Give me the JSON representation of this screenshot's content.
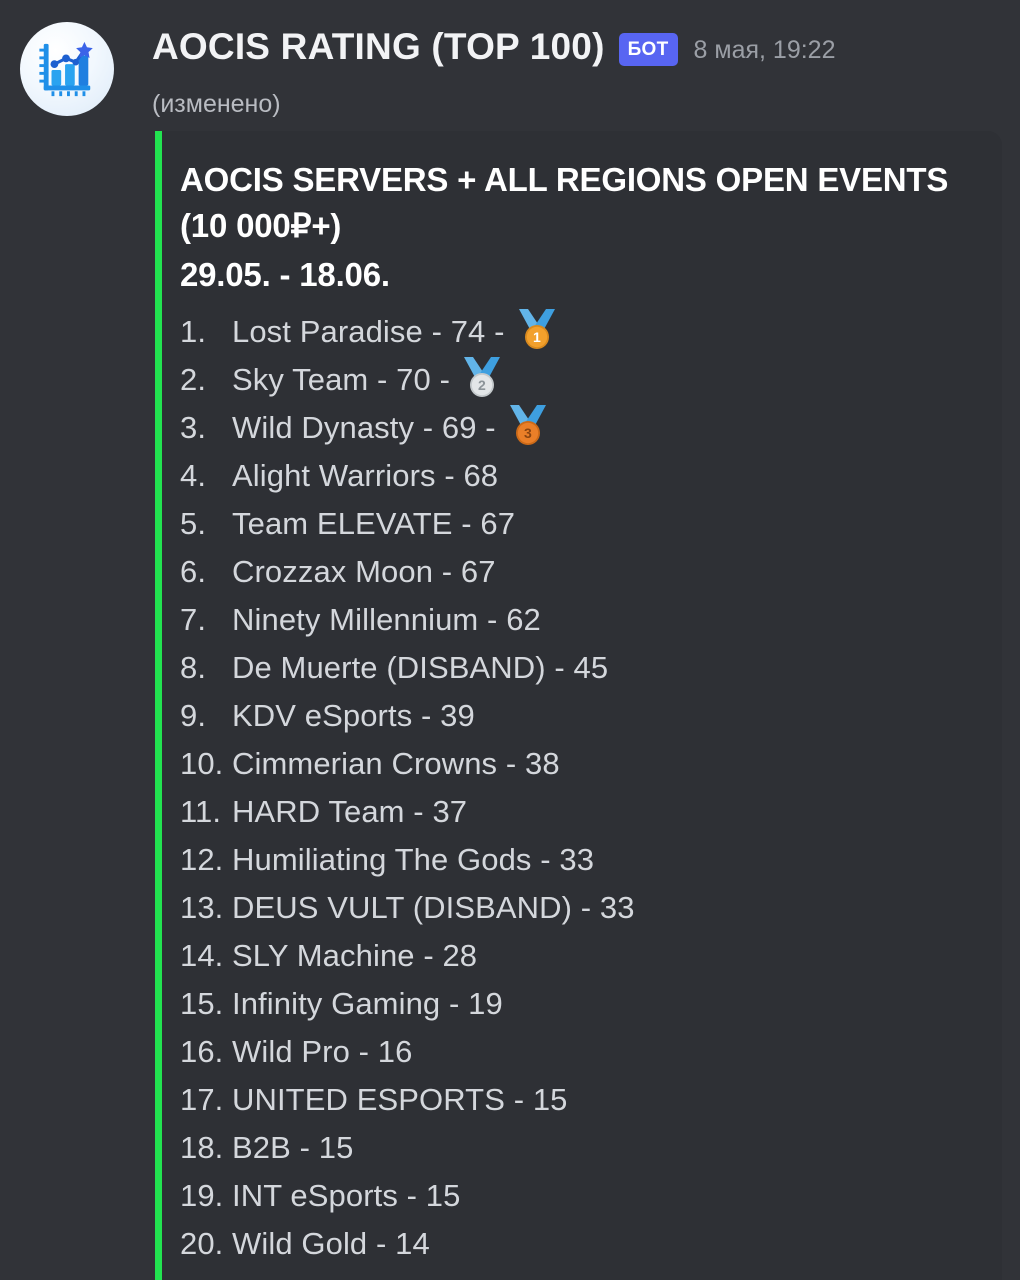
{
  "message": {
    "author": "AOCIS RATING (TOP 100)",
    "bot_badge": "БОТ",
    "timestamp": "8 мая, 19:22",
    "edited_note": "(изменено)",
    "avatar_icon": "bar-chart-star-icon",
    "accent_color": "#22e350",
    "badge_color": "#5865F2"
  },
  "embed": {
    "title": "AOCIS SERVERS + ALL REGIONS OPEN EVENTS (10 000₽+)",
    "title_line1": "AOCIS SERVERS + ALL REGIONS OPEN EVENTS",
    "title_line2": "(10 000₽+)",
    "date_range": "29.05. - 18.06.",
    "entries": [
      {
        "rank": "1.",
        "text": "Lost Paradise - 74 -",
        "team": "Lost Paradise",
        "points": 74,
        "medal": "gold-medal-icon"
      },
      {
        "rank": "2.",
        "text": "Sky Team - 70 -",
        "team": "Sky Team",
        "points": 70,
        "medal": "silver-medal-icon"
      },
      {
        "rank": "3.",
        "text": "Wild Dynasty - 69 -",
        "team": "Wild Dynasty",
        "points": 69,
        "medal": "bronze-medal-icon"
      },
      {
        "rank": "4.",
        "text": "Alight Warriors - 68",
        "team": "Alight Warriors",
        "points": 68,
        "medal": null
      },
      {
        "rank": "5.",
        "text": "Team ELEVATE - 67",
        "team": "Team ELEVATE",
        "points": 67,
        "medal": null
      },
      {
        "rank": "6.",
        "text": "Crozzax Moon - 67",
        "team": "Crozzax Moon",
        "points": 67,
        "medal": null
      },
      {
        "rank": "7.",
        "text": "Ninety Millennium - 62",
        "team": "Ninety Millennium",
        "points": 62,
        "medal": null
      },
      {
        "rank": "8.",
        "text": "De Muerte (DISBAND) - 45",
        "team": "De Muerte (DISBAND)",
        "points": 45,
        "medal": null
      },
      {
        "rank": "9.",
        "text": "KDV eSports - 39",
        "team": "KDV eSports",
        "points": 39,
        "medal": null
      },
      {
        "rank": "10.",
        "text": "Cimmerian Crowns - 38",
        "team": "Cimmerian Crowns",
        "points": 38,
        "medal": null
      },
      {
        "rank": "11.",
        "text": "HARD Team - 37",
        "team": "HARD Team",
        "points": 37,
        "medal": null
      },
      {
        "rank": "12.",
        "text": "Humiliating The Gods - 33",
        "team": "Humiliating The Gods",
        "points": 33,
        "medal": null
      },
      {
        "rank": "13.",
        "text": "DEUS VULT (DISBAND) - 33",
        "team": "DEUS VULT (DISBAND)",
        "points": 33,
        "medal": null
      },
      {
        "rank": "14.",
        "text": "SLY Machine - 28",
        "team": "SLY Machine",
        "points": 28,
        "medal": null
      },
      {
        "rank": "15.",
        "text": "Infinity Gaming - 19",
        "team": "Infinity Gaming",
        "points": 19,
        "medal": null
      },
      {
        "rank": "16.",
        "text": "Wild Pro - 16",
        "team": "Wild Pro",
        "points": 16,
        "medal": null
      },
      {
        "rank": "17.",
        "text": "UNITED ESPORTS - 15",
        "team": "UNITED ESPORTS",
        "points": 15,
        "medal": null
      },
      {
        "rank": "18.",
        "text": "B2B - 15",
        "team": "B2B",
        "points": 15,
        "medal": null
      },
      {
        "rank": "19.",
        "text": "INT eSports - 15",
        "team": "INT eSports",
        "points": 15,
        "medal": null
      },
      {
        "rank": "20.",
        "text": "Wild Gold - 14",
        "team": "Wild Gold",
        "points": 14,
        "medal": null
      }
    ]
  }
}
